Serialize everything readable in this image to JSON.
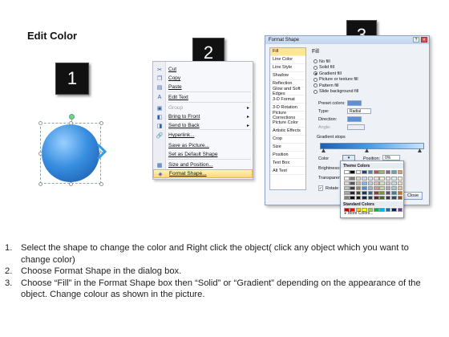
{
  "title": "Edit Color",
  "badges": [
    "1",
    "2",
    "3"
  ],
  "context_menu": {
    "items": [
      {
        "label": "Cut",
        "icon": "scissors-icon",
        "glyph": "✂"
      },
      {
        "label": "Copy",
        "icon": "copy-icon",
        "glyph": "❐"
      },
      {
        "label": "Paste",
        "icon": "paste-icon",
        "glyph": "▤"
      },
      {
        "label": "Edit Text",
        "icon": "edit-text-icon",
        "glyph": "A"
      },
      {
        "label": "Group",
        "icon": "group-icon",
        "glyph": "▣",
        "disabled": true,
        "submenu": true
      },
      {
        "label": "Bring to Front",
        "icon": "bring-front-icon",
        "glyph": "◧",
        "submenu": true
      },
      {
        "label": "Send to Back",
        "icon": "send-back-icon",
        "glyph": "◨",
        "submenu": true
      },
      {
        "label": "Hyperlink...",
        "icon": "hyperlink-icon",
        "glyph": "🔗"
      },
      {
        "label": "Save as Picture...",
        "icon": "",
        "glyph": ""
      },
      {
        "label": "Set as Default Shape",
        "icon": "",
        "glyph": ""
      },
      {
        "label": "Size and Position...",
        "icon": "size-position-icon",
        "glyph": "▦"
      },
      {
        "label": "Format Shape...",
        "icon": "format-shape-icon",
        "glyph": "◈",
        "highlighted": true
      }
    ]
  },
  "dialog": {
    "title": "Format Shape",
    "categories": [
      "Fill",
      "Line Color",
      "Line Style",
      "Shadow",
      "Reflection",
      "Glow and Soft Edges",
      "3-D Format",
      "3-D Rotation",
      "Picture Corrections",
      "Picture Color",
      "Artistic Effects",
      "Crop",
      "Size",
      "Position",
      "Text Box",
      "Alt Text"
    ],
    "fill_heading": "Fill",
    "fill_options": [
      {
        "label": "No fill",
        "selected": false
      },
      {
        "label": "Solid fill",
        "selected": false
      },
      {
        "label": "Gradient fill",
        "selected": true
      },
      {
        "label": "Picture or texture fill",
        "selected": false
      },
      {
        "label": "Pattern fill",
        "selected": false
      },
      {
        "label": "Slide background fill",
        "selected": false
      }
    ],
    "preset_colors_label": "Preset colors:",
    "type_label": "Type:",
    "type_value": "Radial",
    "direction_label": "Direction:",
    "angle_label": "Angle:",
    "gradient_stops_label": "Gradient stops",
    "color_label": "Color",
    "position_label": "Position:",
    "position_value": "0%",
    "brightness_label": "Brightness:",
    "transparency_label": "Transparency:",
    "rotate_label": "Rotate with shape",
    "close_button": "Close"
  },
  "palette": {
    "theme_label": "Theme Colors",
    "standard_label": "Standard Colors",
    "more_label": "More Colors...",
    "theme_top": [
      "#ffffff",
      "#000000",
      "#eeece1",
      "#1f497d",
      "#4f81bd",
      "#c0504d",
      "#9bbb59",
      "#8064a2",
      "#4bacc6",
      "#f79646"
    ],
    "theme_shades": [
      [
        "#f2f2f2",
        "#7f7f7f",
        "#ddd9c3",
        "#c6d9f0",
        "#dbe5f1",
        "#f2dcdb",
        "#ebf1dd",
        "#e5e0ec",
        "#dbeef3",
        "#fdeada"
      ],
      [
        "#d8d8d8",
        "#595959",
        "#c4bd97",
        "#8db3e2",
        "#b8cce4",
        "#e5b9b7",
        "#d7e3bc",
        "#ccc1d9",
        "#b7dde8",
        "#fbd5b5"
      ],
      [
        "#bfbfbf",
        "#3f3f3f",
        "#938953",
        "#548dd4",
        "#95b3d7",
        "#d99694",
        "#c3d69b",
        "#b2a2c7",
        "#92cddc",
        "#fac08f"
      ],
      [
        "#a5a5a5",
        "#262626",
        "#494429",
        "#17365d",
        "#366092",
        "#953734",
        "#76923c",
        "#5f497a",
        "#31859b",
        "#e36c09"
      ],
      [
        "#7f7f7f",
        "#0c0c0c",
        "#1d1b10",
        "#0f243e",
        "#244061",
        "#632423",
        "#4f6128",
        "#3f3151",
        "#205867",
        "#974806"
      ]
    ],
    "standard": [
      "#c00000",
      "#ff0000",
      "#ffc000",
      "#ffff00",
      "#92d050",
      "#00b050",
      "#00b0f0",
      "#0070c0",
      "#002060",
      "#7030a0"
    ]
  },
  "instructions": [
    {
      "num": "1.",
      "text": "Select the shape to change the color and Right click the object( click any object which you want to change color)"
    },
    {
      "num": "2.",
      "text": "Choose Format Shape in the dialog box."
    },
    {
      "num": "3.",
      "text": "Choose “Fill” in the Format Shape box then “Solid” or “Gradient” depending on the appearance of the object. Change colour as shown in the picture."
    }
  ]
}
